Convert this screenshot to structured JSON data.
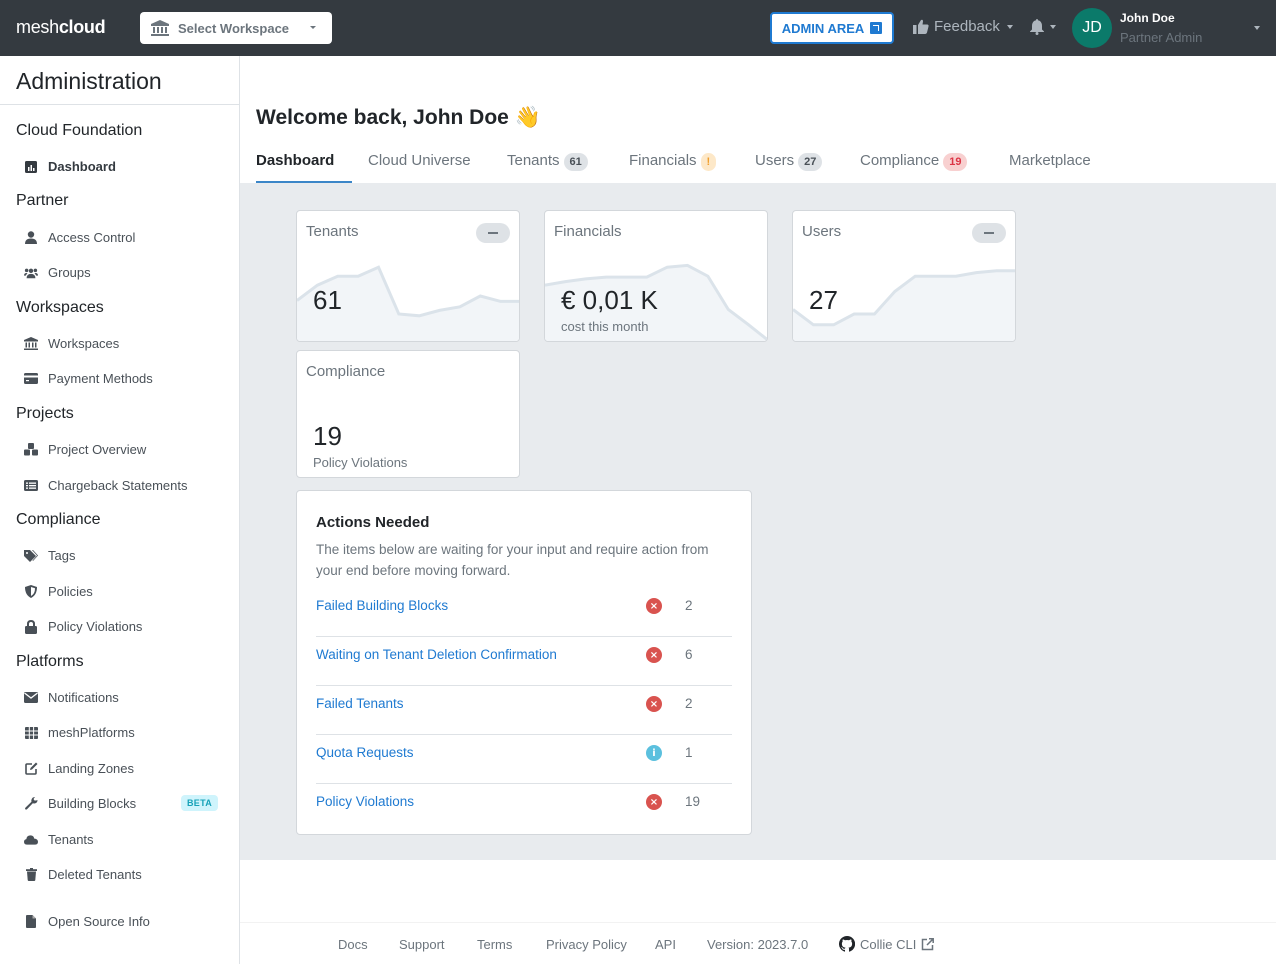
{
  "navbar": {
    "logo_light": "mesh",
    "logo_bold": "cloud",
    "workspace_select": "Select Workspace",
    "admin_area": "ADMIN AREA",
    "feedback": "Feedback",
    "user": {
      "initials": "JD",
      "name": "John Doe",
      "role": "Partner Admin"
    }
  },
  "sidebar": {
    "title": "Administration",
    "sections": [
      {
        "label": "Cloud Foundation",
        "items": [
          {
            "label": "Dashboard",
            "icon": "chart-icon",
            "active": true
          }
        ]
      },
      {
        "label": "Partner",
        "items": [
          {
            "label": "Access Control",
            "icon": "user-icon"
          },
          {
            "label": "Groups",
            "icon": "users-icon"
          }
        ]
      },
      {
        "label": "Workspaces",
        "items": [
          {
            "label": "Workspaces",
            "icon": "bank-icon"
          },
          {
            "label": "Payment Methods",
            "icon": "credit-card-icon"
          }
        ]
      },
      {
        "label": "Projects",
        "items": [
          {
            "label": "Project Overview",
            "icon": "cubes-icon"
          },
          {
            "label": "Chargeback Statements",
            "icon": "list-icon"
          }
        ]
      },
      {
        "label": "Compliance",
        "items": [
          {
            "label": "Tags",
            "icon": "tags-icon"
          },
          {
            "label": "Policies",
            "icon": "shield-icon"
          },
          {
            "label": "Policy Violations",
            "icon": "lock-icon"
          }
        ]
      },
      {
        "label": "Platforms",
        "items": [
          {
            "label": "Notifications",
            "icon": "envelope-icon"
          },
          {
            "label": "meshPlatforms",
            "icon": "grid-icon"
          },
          {
            "label": "Landing Zones",
            "icon": "edit-icon"
          },
          {
            "label": "Building Blocks",
            "icon": "wrench-icon",
            "badge": "BETA"
          },
          {
            "label": "Tenants",
            "icon": "cloud-icon"
          },
          {
            "label": "Deleted Tenants",
            "icon": "trash-icon"
          }
        ]
      }
    ],
    "footer_item": {
      "label": "Open Source Info",
      "icon": "file-icon"
    }
  },
  "main": {
    "welcome": "Welcome back, John Doe",
    "welcome_emoji": "👋",
    "tabs": [
      {
        "label": "Dashboard",
        "active": true
      },
      {
        "label": "Cloud Universe"
      },
      {
        "label": "Tenants",
        "badge": "61"
      },
      {
        "label": "Financials",
        "badge": "!"
      },
      {
        "label": "Users",
        "badge": "27"
      },
      {
        "label": "Compliance",
        "badge": "19"
      },
      {
        "label": "Marketplace"
      }
    ],
    "kpis": {
      "tenants": {
        "title": "Tenants",
        "value": "61",
        "trend": [
          0.45,
          0.62,
          0.72,
          0.72,
          0.82,
          0.3,
          0.28,
          0.34,
          0.38,
          0.5,
          0.44,
          0.44
        ]
      },
      "financials": {
        "title": "Financials",
        "value": "€ 0,01 K",
        "sub": "cost this month",
        "trend": [
          0.62,
          0.66,
          0.69,
          0.71,
          0.71,
          0.71,
          0.82,
          0.84,
          0.72,
          0.35,
          0.18,
          0.0
        ]
      },
      "users": {
        "title": "Users",
        "value": "27",
        "trend": [
          0.35,
          0.18,
          0.18,
          0.3,
          0.3,
          0.55,
          0.72,
          0.72,
          0.72,
          0.76,
          0.78,
          0.78
        ]
      },
      "compliance": {
        "title": "Compliance",
        "value": "19",
        "sub": "Policy Violations"
      }
    },
    "actions": {
      "title": "Actions Needed",
      "description": "The items below are waiting for your input and require action from your end before moving forward.",
      "rows": [
        {
          "label": "Failed Building Blocks",
          "status": "error",
          "count": "2"
        },
        {
          "label": "Waiting on Tenant Deletion Confirmation",
          "status": "error",
          "count": "6"
        },
        {
          "label": "Failed Tenants",
          "status": "error",
          "count": "2"
        },
        {
          "label": "Quota Requests",
          "status": "info",
          "count": "1"
        },
        {
          "label": "Policy Violations",
          "status": "error",
          "count": "19"
        }
      ]
    }
  },
  "footer": {
    "links": [
      "Docs",
      "Support",
      "Terms",
      "Privacy Policy",
      "API"
    ],
    "version": "Version: 2023.7.0",
    "cli": "Collie CLI"
  },
  "colors": {
    "navbar": "#343a40",
    "accent": "#1f7ad1",
    "avatar": "#0b7a6a",
    "error": "#d9534f",
    "info": "#5bc0de"
  }
}
